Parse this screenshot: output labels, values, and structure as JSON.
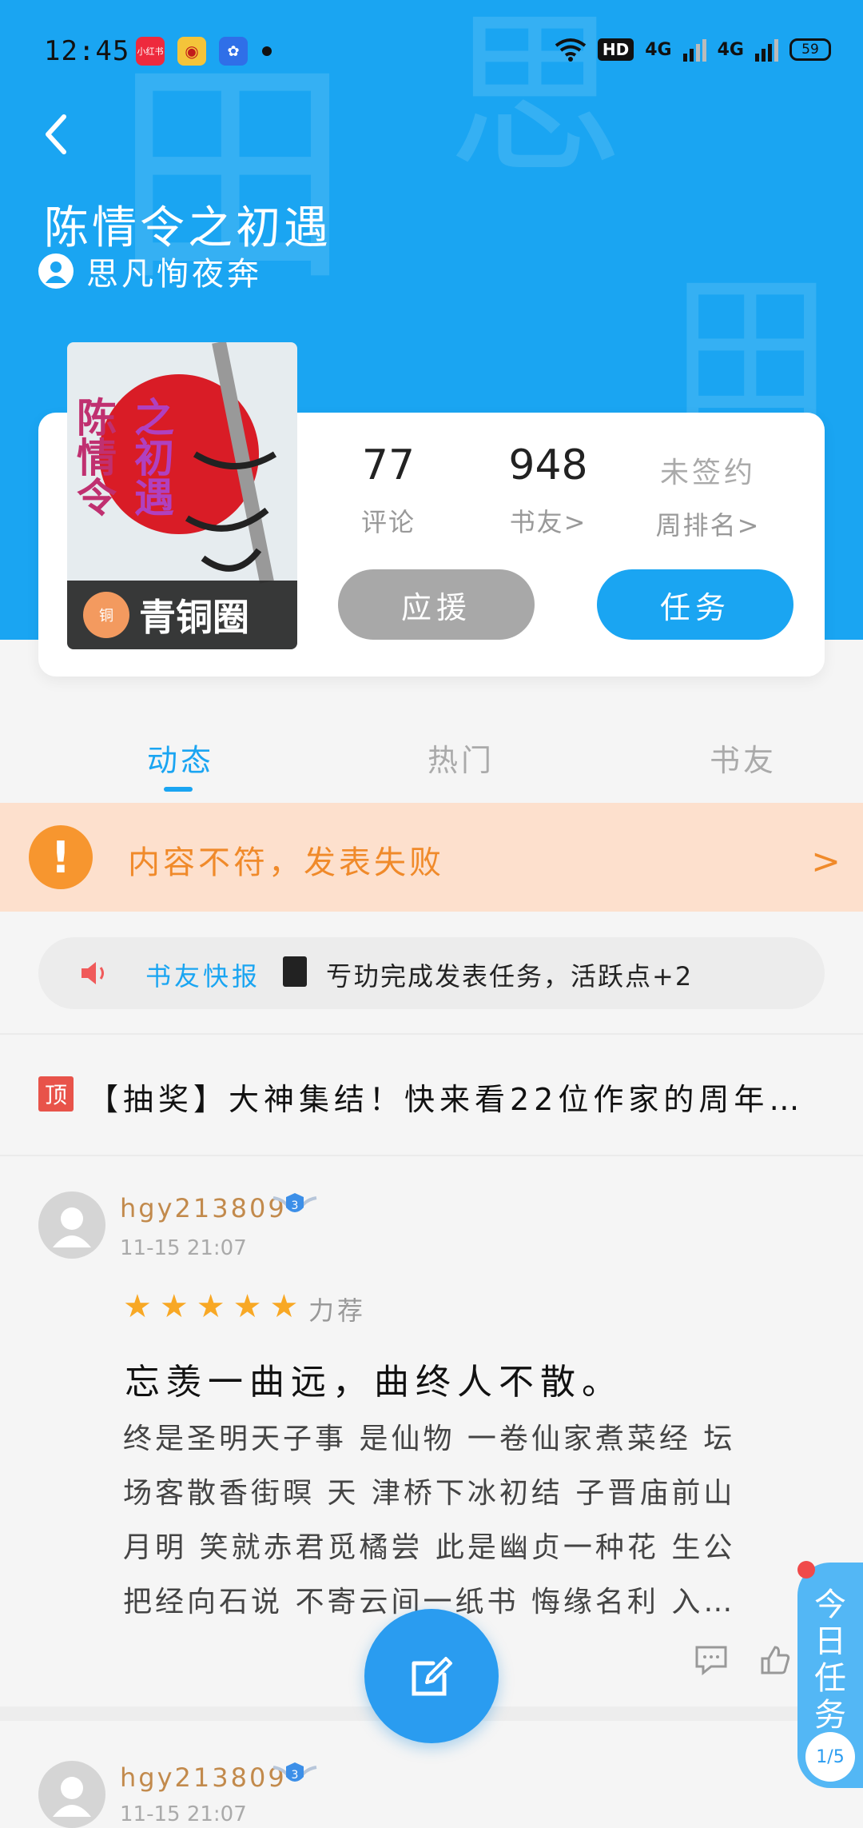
{
  "status_bar": {
    "time": "12:45",
    "apps": [
      "小红书",
      "微博",
      "百度"
    ],
    "hd_label": "HD",
    "net1": "4G",
    "net2": "4G",
    "battery": "59"
  },
  "header": {
    "title": "陈情令之初遇",
    "author": "思凡恂夜奔",
    "bg_color": "#1aa5f2"
  },
  "book": {
    "cover_title": "陈情令之初遇",
    "circle_badge": "青铜圈",
    "medal_label": "铜",
    "stats": [
      {
        "value": "77",
        "label": "评论"
      },
      {
        "value": "948",
        "label": "书友>"
      },
      {
        "value": "未签约",
        "label": "周排名>"
      }
    ],
    "support_button": "应援",
    "task_button": "任务"
  },
  "tabs": [
    {
      "label": "动态",
      "active": true
    },
    {
      "label": "热门",
      "active": false
    },
    {
      "label": "书友",
      "active": false
    }
  ],
  "warning": {
    "text": "内容不符，发表失败",
    "color": "#f7962f"
  },
  "news": {
    "label": "书友快报",
    "message": "亐玏完成发表任务，活跃点+2"
  },
  "pinned": {
    "badge": "顶",
    "text": "【抽奖】大神集结！快来看22位作家的周年…"
  },
  "posts": [
    {
      "username": "hgy213809",
      "level": "3",
      "time": "11-15 21:07",
      "rating": 5,
      "rating_label": "力荐",
      "title": "忘羡一曲远，曲终人不散。",
      "body_lines": [
        "终是圣明天子事 是仙物 一卷仙家煮菜经 坛",
        "场客散香街暝 天 津桥下冰初结 子晋庙前山",
        "月明 笑就赤君觅橘尝 此是幽贞一种花 生公",
        "把经向石说 不寄云间一纸书 悔缘名利 入…"
      ]
    },
    {
      "username": "hgy213809",
      "level": "3",
      "time": "11-15 21:07"
    }
  ],
  "floating_task": {
    "label": "今日任务",
    "progress": "1/5"
  }
}
